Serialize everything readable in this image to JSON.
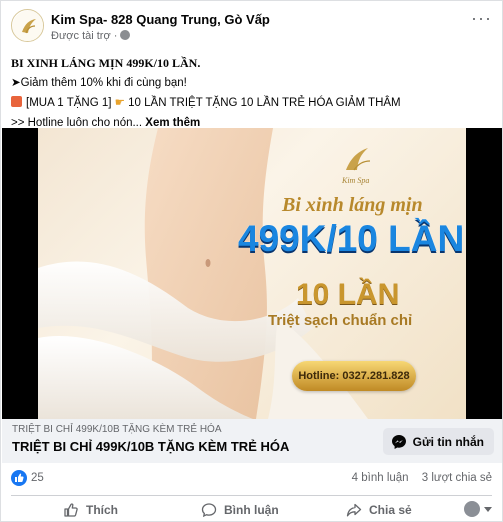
{
  "header": {
    "page_name": "Kim Spa- 828 Quang Trung, Gò Vấp",
    "sponsored": "Được tài trợ ·"
  },
  "post": {
    "line1": "BI XINH LÁNG MỊN 499K/10 LẦN.",
    "line2": "➤Giảm thêm 10% khi đi cùng bạn!",
    "line3": "[MUA 1 TẶNG 1]",
    "line3_rest": "10 LẦN TRIỆT TẶNG 10 LẦN TRẺ HÓA GIẢM THÂM",
    "line4": ">> Hotline luôn cho nón...",
    "see_more": "Xem thêm"
  },
  "ad": {
    "brand": "Kim Spa",
    "headline_script": "Bi xinh láng mịn",
    "headline_price": "499K/10 LẦN",
    "times": "10 LẦN",
    "subline": "Triệt sạch chuẩn chỉ",
    "hotline": "Hotline: 0327.281.828"
  },
  "caption": {
    "small": "TRIỆT BI CHỈ 499K/10B TẶNG KÈM TRẺ HÓA",
    "big": "TRIỆT BI CHỈ 499K/10B TẶNG KÈM TRẺ HÓA",
    "message_button": "Gửi tin nhắn"
  },
  "stats": {
    "likes": "25",
    "comments": "4 bình luận",
    "shares": "3 lượt chia sẻ"
  },
  "actions": {
    "like": "Thích",
    "comment": "Bình luận",
    "share": "Chia sẻ"
  },
  "colors": {
    "brand_blue": "#1877f2",
    "gold": "#c9a24a"
  }
}
